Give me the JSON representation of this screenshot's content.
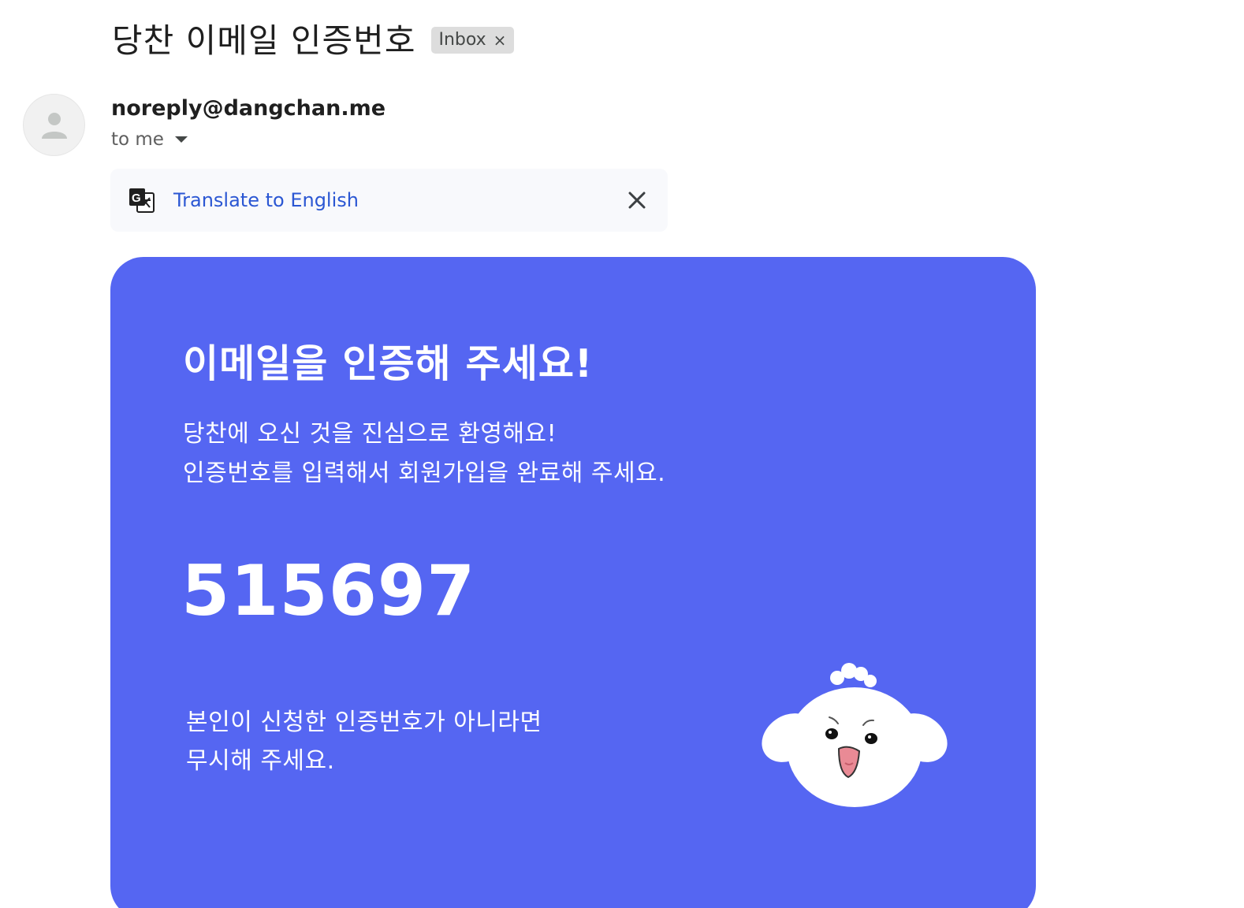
{
  "email": {
    "subject": "당찬 이메일 인증번호",
    "label": "Inbox",
    "label_remove": "×",
    "sender": "noreply@dangchan.me",
    "recipient": "to me"
  },
  "translate": {
    "link_text": "Translate to English"
  },
  "card": {
    "background_color": "#5566f2",
    "heading": "이메일을 인증해 주세요!",
    "welcome_line1": "당찬에 오신 것을 진심으로 환영해요!",
    "welcome_line2": "인증번호를 입력해서 회원가입을 완료해 주세요.",
    "code": "515697",
    "ignore_line1": "본인이 신청한 인증번호가 아니라면",
    "ignore_line2": "무시해 주세요."
  }
}
